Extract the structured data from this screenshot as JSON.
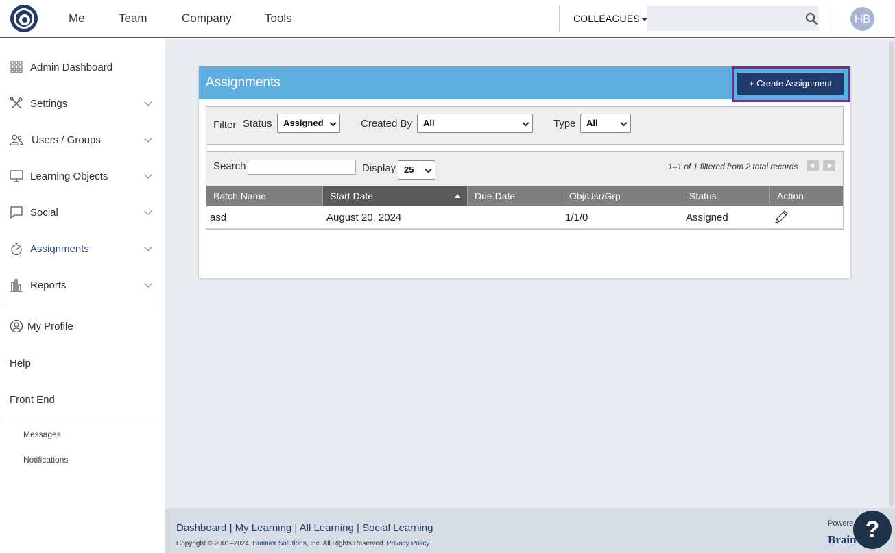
{
  "topbar": {
    "nav": [
      "Me",
      "Team",
      "Company",
      "Tools"
    ],
    "colleagues_label": "COLLEAGUES",
    "search_value": "",
    "avatar_initials": "HB"
  },
  "sidebar": {
    "items": [
      {
        "label": "Admin Dashboard",
        "icon": "grid-icon",
        "has_children": false
      },
      {
        "label": "Settings",
        "icon": "tools-icon",
        "has_children": true
      },
      {
        "label": "Users / Groups",
        "icon": "users-icon",
        "has_children": true
      },
      {
        "label": "Learning Objects",
        "icon": "monitor-icon",
        "has_children": true
      },
      {
        "label": "Social",
        "icon": "chat-icon",
        "has_children": true
      },
      {
        "label": "Assignments",
        "icon": "stopwatch-icon",
        "has_children": true,
        "active": true
      },
      {
        "label": "Reports",
        "icon": "bar-chart-icon",
        "has_children": true
      }
    ],
    "profile_label": "My Profile",
    "help_label": "Help",
    "front_end_label": "Front End",
    "messages_label": "Messages",
    "notifications_label": "Notifications"
  },
  "panel": {
    "title": "Assignments",
    "create_label": "+ Create Assignment",
    "filter": {
      "filter_label": "Filter",
      "status_label": "Status",
      "status_value": "Assigned",
      "created_by_label": "Created By",
      "created_by_value": "All",
      "type_label": "Type",
      "type_value": "All"
    },
    "table": {
      "search_label": "Search",
      "search_value": "",
      "display_label": "Display",
      "display_value": "25",
      "records_text": "1–1 of 1 filtered from 2 total records",
      "columns": [
        "Batch Name",
        "Start Date",
        "Due Date",
        "Obj/Usr/Grp",
        "Status",
        "Action"
      ],
      "sorted_column": "Start Date",
      "rows": [
        {
          "batch_name": "asd",
          "start_date": "August 20, 2024",
          "due_date": "",
          "obj_usr_grp": "1/1/0",
          "status": "Assigned",
          "action_icon": "pencil-icon"
        }
      ]
    }
  },
  "footer": {
    "links": [
      "Dashboard",
      "My Learning",
      "All Learning",
      "Social Learning"
    ],
    "copyright_prefix": "Copyright © 2001–2024,",
    "company_link": "Brainier Solutions, Inc.",
    "rights": "All Rights Reserved.",
    "privacy_link": "Privacy Policy",
    "powered_text": "Powere",
    "brand_text": "Brain"
  },
  "help_button_label": "?",
  "colors": {
    "accent": "#5faee0",
    "navy": "#1f3a6b",
    "highlight": "#7a2a8c"
  }
}
